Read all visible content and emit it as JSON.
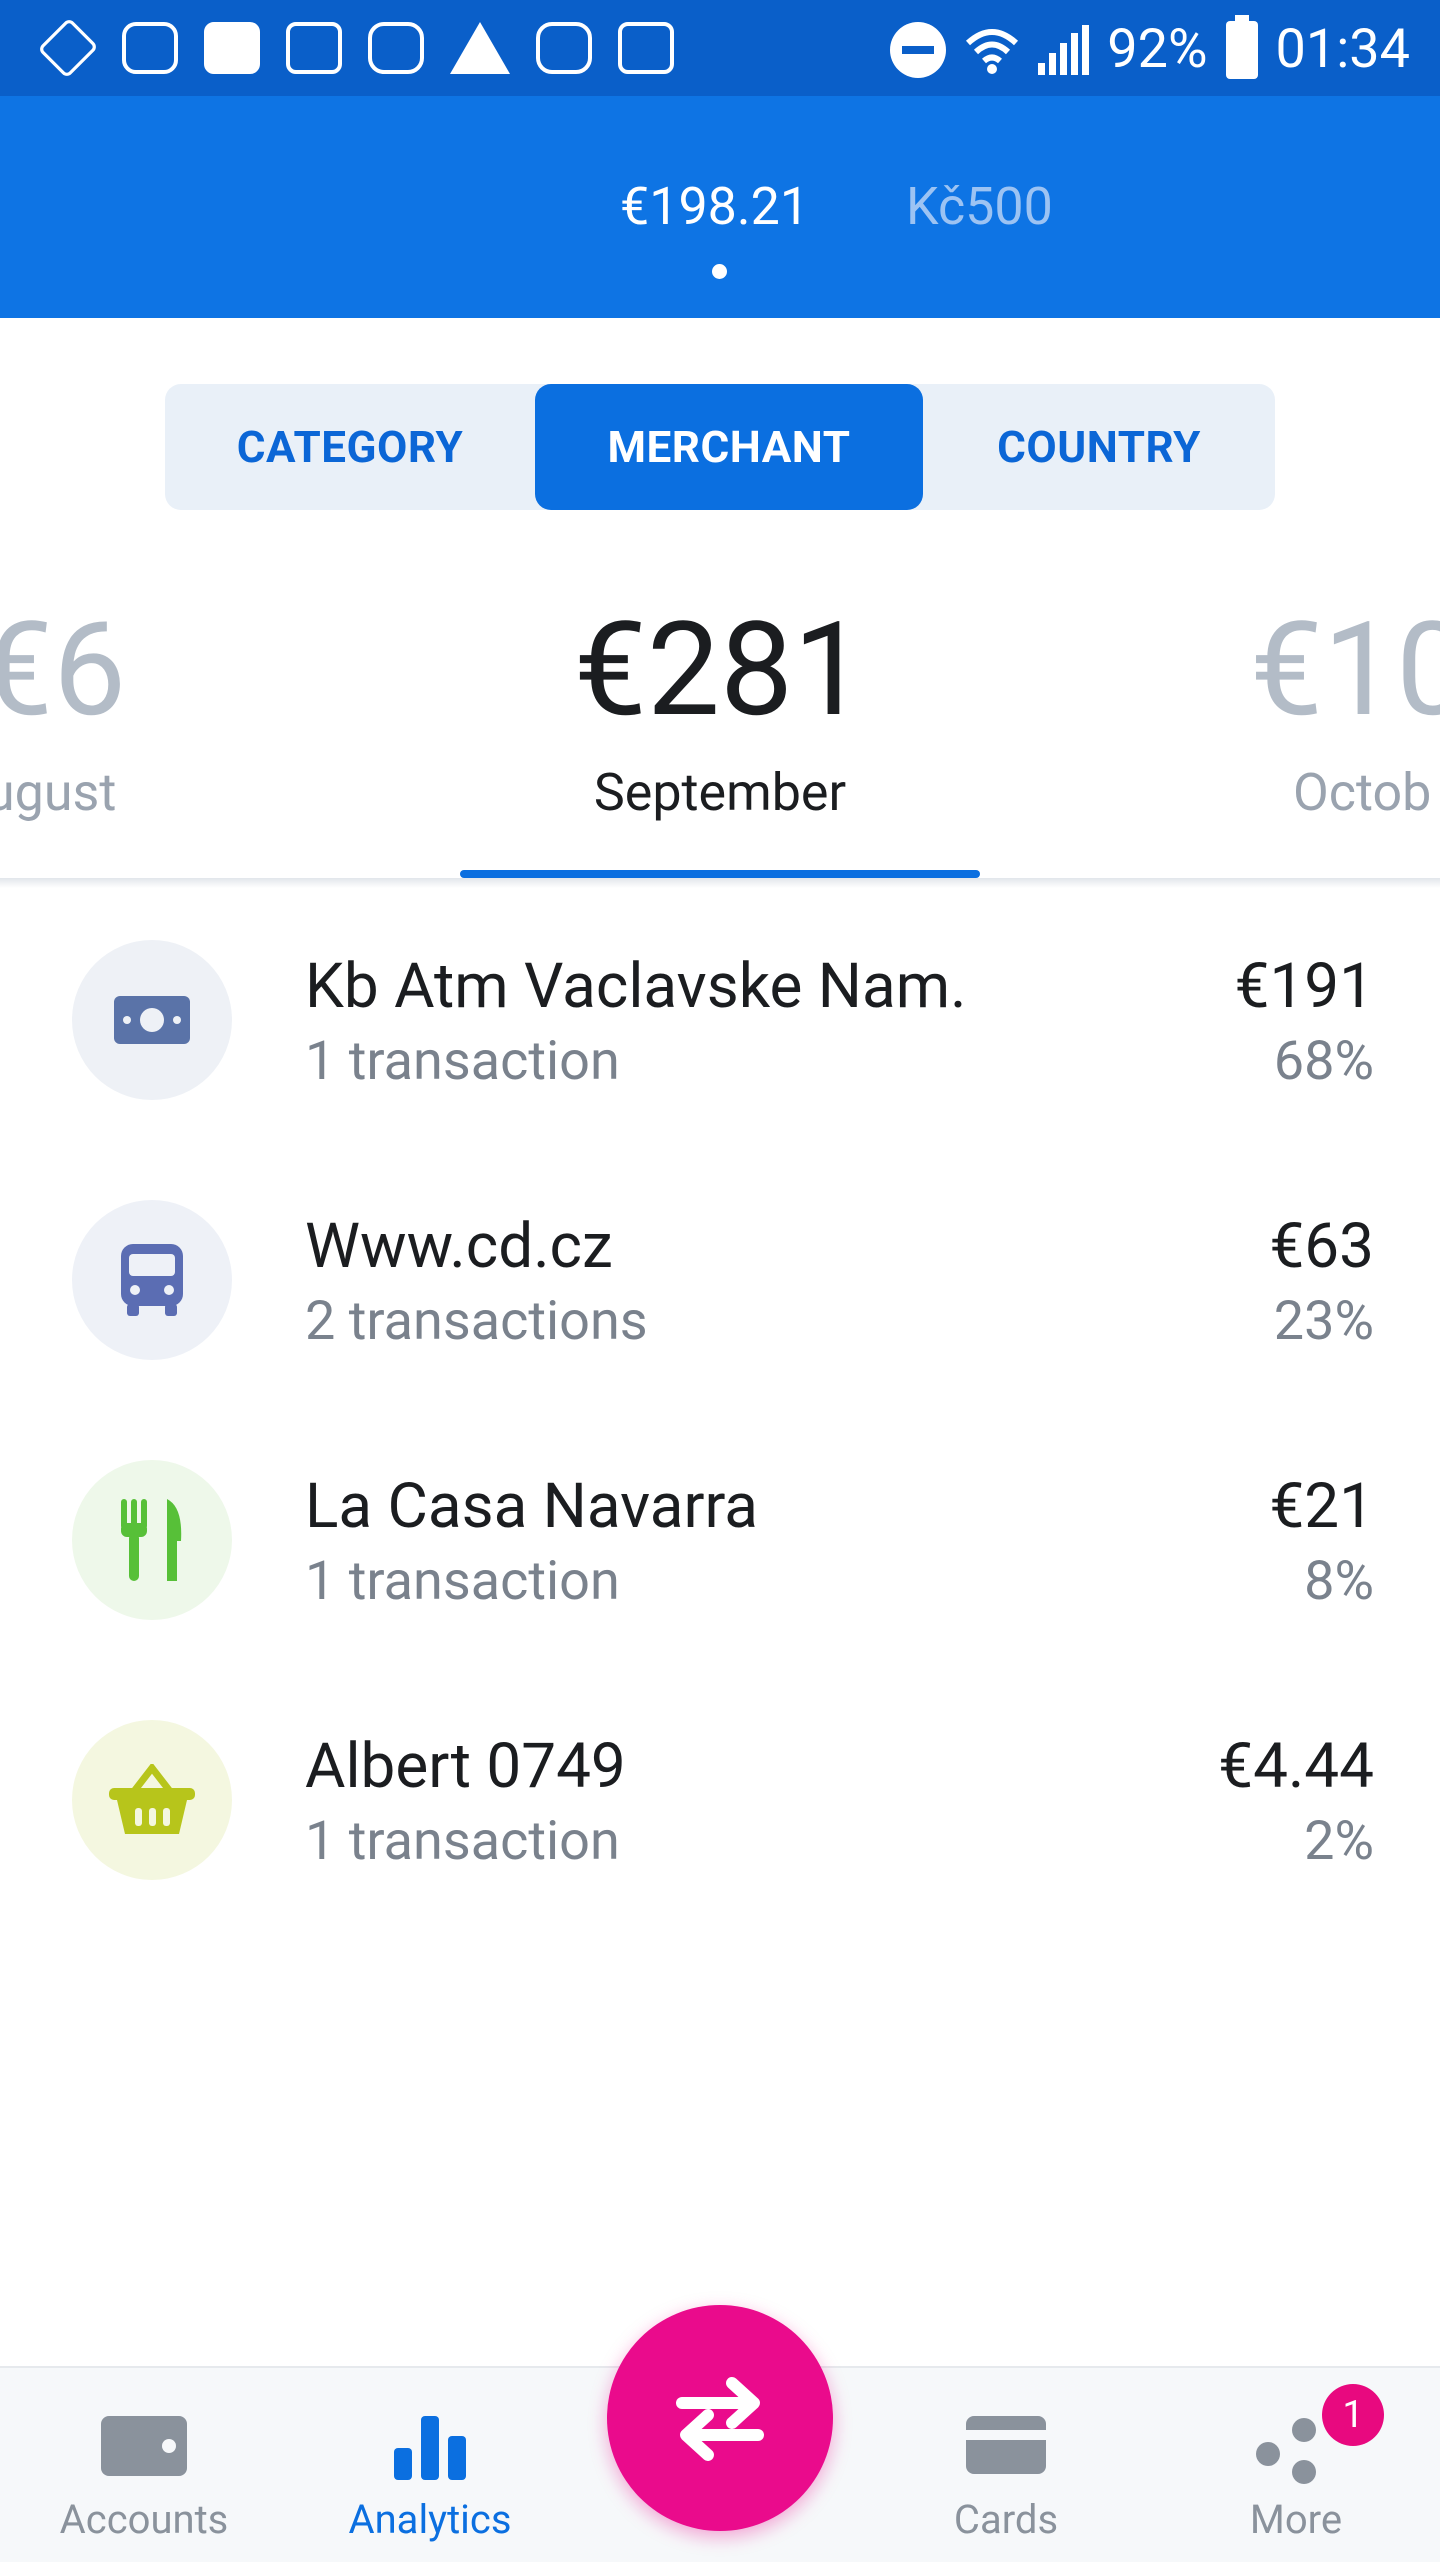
{
  "status_bar": {
    "battery": "92%",
    "time": "01:34",
    "left_icons": [
      "tag-icon",
      "cd-app-icon",
      "gallery-icon",
      "gmail-icon",
      "instagram-icon",
      "warning-icon",
      "instagram-icon",
      "maps-icon"
    ]
  },
  "header": {
    "balances": [
      "€198.21",
      "Kč500"
    ],
    "active_balance_index": 0
  },
  "segments": {
    "items": [
      "CATEGORY",
      "MERCHANT",
      "COUNTRY"
    ],
    "selected": "MERCHANT"
  },
  "periods": {
    "previous": {
      "amount": "€6",
      "month": "ugust"
    },
    "current": {
      "amount": "€281",
      "month": "September"
    },
    "next": {
      "amount": "€10",
      "month": "Octob"
    }
  },
  "merchants": [
    {
      "name": "Kb Atm Vaclavske Nam.",
      "count": "1 transaction",
      "amount": "€191",
      "percent": "68%",
      "icon": "cash-icon",
      "color": "#5a73a8",
      "bg": "#eef1f6"
    },
    {
      "name": "Www.cd.cz",
      "count": "2 transactions",
      "amount": "€63",
      "percent": "23%",
      "icon": "bus-icon",
      "color": "#5b6db3",
      "bg": "#eef1f7"
    },
    {
      "name": "La Casa Navarra",
      "count": "1 transaction",
      "amount": "€21",
      "percent": "8%",
      "icon": "restaurant-icon",
      "color": "#57c038",
      "bg": "#eef8ea"
    },
    {
      "name": "Albert 0749",
      "count": "1 transaction",
      "amount": "€4.44",
      "percent": "2%",
      "icon": "basket-icon",
      "color": "#b7c51b",
      "bg": "#f4f7e0"
    }
  ],
  "bottom_nav": {
    "items": [
      "Accounts",
      "Analytics",
      "Cards",
      "More"
    ],
    "active": "Analytics",
    "more_badge": "1"
  },
  "colors": {
    "primary": "#0e74e4",
    "accent": "#ea0b8c",
    "text": "#1b1d20",
    "muted": "#7a828d"
  }
}
